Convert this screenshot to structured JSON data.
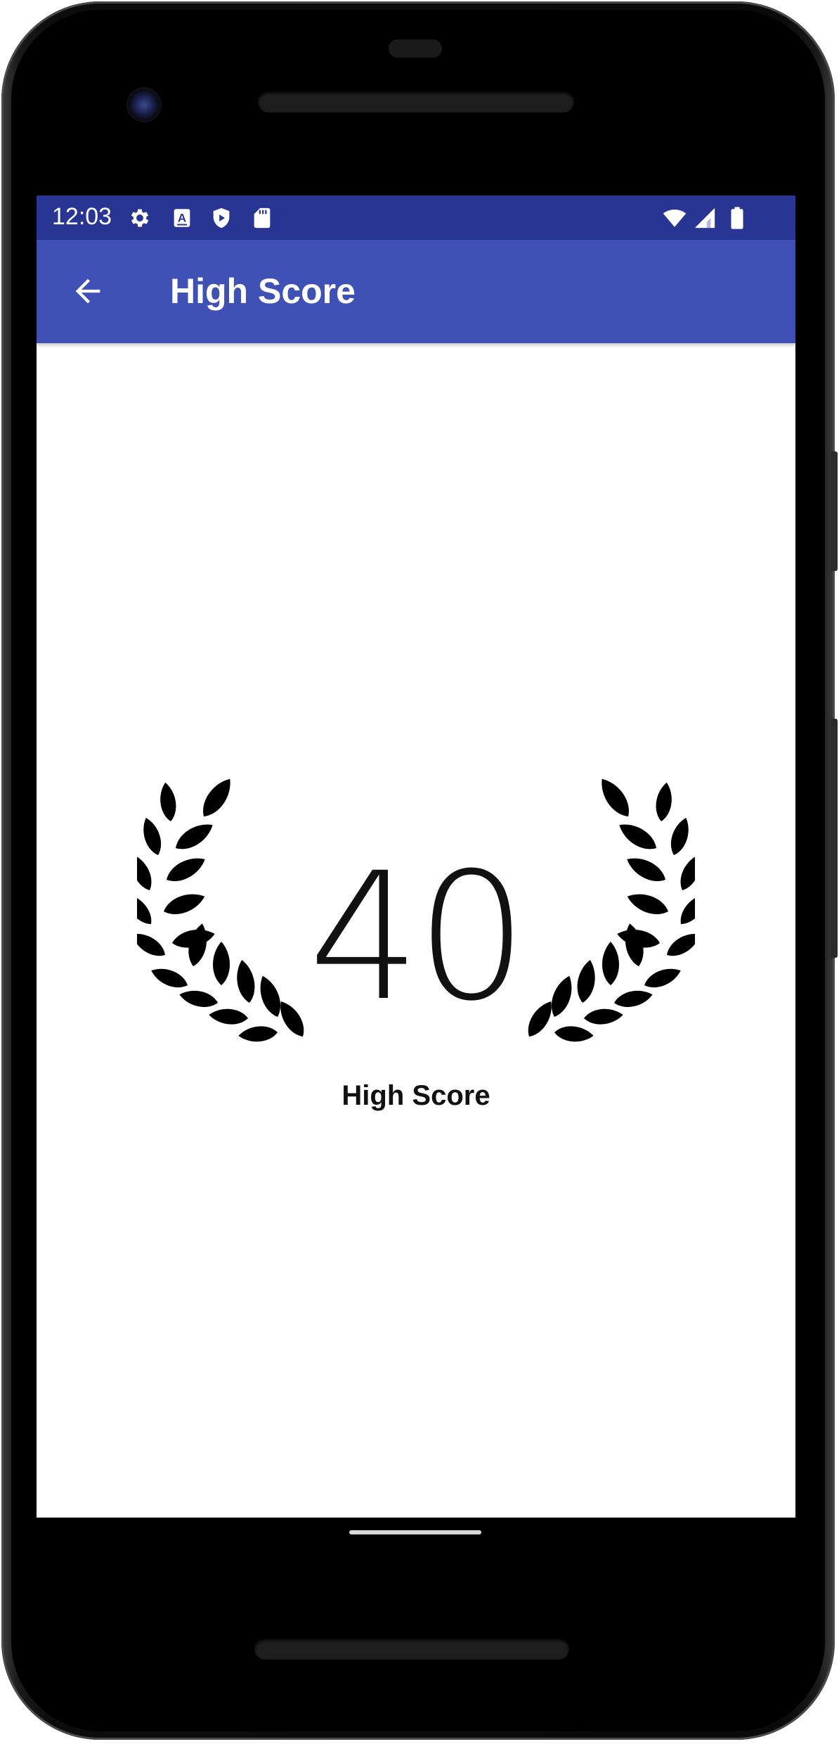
{
  "status_bar": {
    "time": "12:03",
    "left_icons": [
      "settings-icon",
      "font-icon",
      "shield-play-icon",
      "sd-card-icon"
    ],
    "right_icons": [
      "wifi-icon",
      "signal-icon",
      "battery-icon"
    ]
  },
  "app_bar": {
    "back_icon": "arrow-back-icon",
    "title": "High Score"
  },
  "main": {
    "score": "40",
    "score_label": "High Score",
    "emblem": "laurel-wreath-icon"
  },
  "colors": {
    "status_bar": "#283593",
    "app_bar": "#3f51b5",
    "background": "#ffffff",
    "text": "#111111"
  }
}
